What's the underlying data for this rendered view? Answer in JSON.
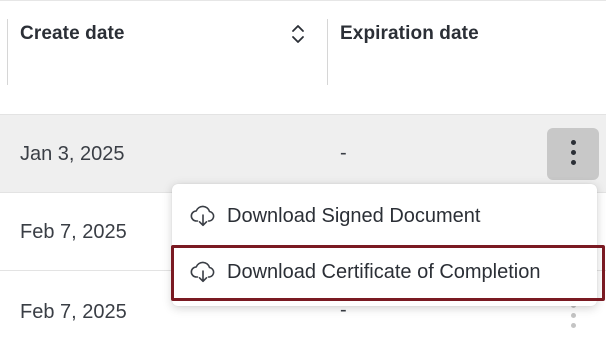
{
  "table": {
    "columns": [
      {
        "label": "Create date",
        "sortable": true
      },
      {
        "label": "Expiration date",
        "sortable": false
      }
    ],
    "rows": [
      {
        "create_date": "Jan 3, 2025",
        "expiration_date": "-",
        "selected": true
      },
      {
        "create_date": "Feb 7, 2025",
        "expiration_date": ""
      },
      {
        "create_date": "Feb 7, 2025",
        "expiration_date": "-"
      }
    ]
  },
  "menu": {
    "items": [
      {
        "label": "Download Signed Document",
        "icon": "cloud-download-icon"
      },
      {
        "label": "Download Certificate of Completion",
        "icon": "cloud-download-icon",
        "highlighted": true
      }
    ]
  },
  "colors": {
    "selected_row_bg": "#efefef",
    "action_button_bg": "#c8c8c8",
    "highlight_border": "#7a1a22",
    "text": "#2b2f36"
  },
  "icons": {
    "sort": "sort-up-down-icon",
    "row_actions": "more-vertical-icon"
  }
}
